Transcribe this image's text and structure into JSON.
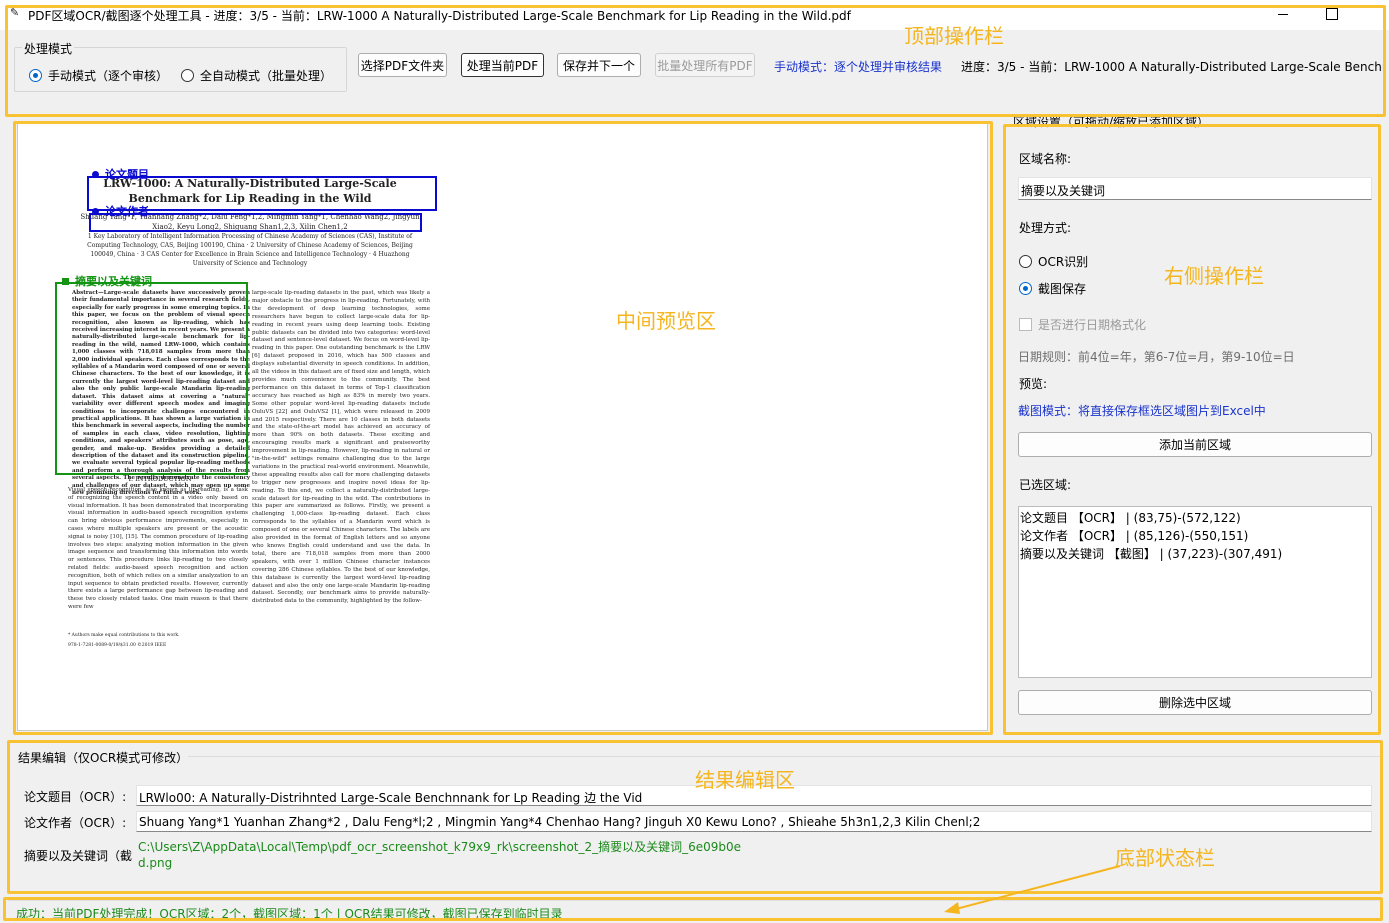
{
  "window": {
    "title": "PDF区域OCR/截图逐个处理工具 - 进度：3/5 - 当前：LRW-1000 A Naturally-Distributed Large-Scale Benchmark for Lip Reading in the Wild.pdf"
  },
  "annotations": {
    "top_bar": "顶部操作栏",
    "preview": "中间预览区",
    "right_panel": "右侧操作栏",
    "results": "结果编辑区",
    "status": "底部状态栏"
  },
  "toolbar": {
    "mode_group_title": "处理模式",
    "mode_manual": "手动模式（逐个审核）",
    "mode_auto": "全自动模式（批量处理）",
    "selected_mode": "manual",
    "select_folder": "选择PDF文件夹",
    "process_current": "处理当前PDF",
    "save_next": "保存并下一个",
    "batch_process": "批量处理所有PDF",
    "mode_hint": "手动模式：逐个处理并审核结果",
    "progress": "进度：3/5 - 当前：LRW-1000 A Naturally-Distributed Large-Scale Benchmark for Lip Reading in the Wild.pdf"
  },
  "preview": {
    "regions": [
      {
        "label": "论文题目",
        "color": "#0a0ad0"
      },
      {
        "label": "论文作者",
        "color": "#0a0ad0"
      },
      {
        "label": "摘要以及关键词",
        "color": "#139413"
      }
    ],
    "paper": {
      "title": "LRW-1000: A Naturally-Distributed Large-Scale Benchmark for Lip Reading in the Wild",
      "authors": "Shuang Yang*1, Yuanhang Zhang*2, Dalu Feng*1,2, Mingmin Yang*1, Chenhao Wang2, Jingyun Xiao2, Keyu Long2, Shiguang Shan1,2,3, Xilin Chen1,2",
      "affiliations": "1 Key Laboratory of Intelligent Information Processing of Chinese Academy of Sciences (CAS), Institute of Computing Technology, CAS, Beijing 100190, China · 2 University of Chinese Academy of Sciences, Beijing 100049, China · 3 CAS Center for Excellence in Brain Science and Intelligence Technology · 4 Huazhong University of Science and Technology",
      "abstract": "Abstract—Large-scale datasets have successively proven their fundamental importance in several research fields, especially for early progress in some emerging topics. In this paper, we focus on the problem of visual speech recognition, also known as lip-reading, which has received increasing interest in recent years. We present a naturally-distributed large-scale benchmark for lip-reading in the wild, named LRW-1000, which contains 1,000 classes with 718,018 samples from more than 2,000 individual speakers. Each class corresponds to the syllables of a Mandarin word composed of one or several Chinese characters. To the best of our knowledge, it is currently the largest word-level lip-reading dataset and also the only public large-scale Mandarin lip-reading dataset. This dataset aims at covering a \"natural\" variability over different speech modes and imaging conditions to incorporate challenges encountered in practical applications. It has shown a large variation in this benchmark in several aspects, including the number of samples in each class, video resolution, lighting conditions, and speakers' attributes such as pose, age, gender, and make-up. Besides providing a detailed description of the dataset and its construction pipeline, we evaluate several typical popular lip-reading methods and perform a thorough analysis of the results from several aspects. The results demonstrate the consistency and challenges of our dataset, which may open up some new promising directions for future work.",
      "intro_heading": "I. INTRODUCTION",
      "col_left": "Visual speech recognition, also known as lip-reading, is a task of recognizing the speech content in a video only based on visual information. It has been demonstrated that incorporating visual information in audio-based speech recognition systems can bring obvious performance improvements, especially in cases where multiple speakers are present or the acoustic signal is noisy [10], [15]. The common procedure of lip-reading involves two steps: analyzing motion information in the given image sequence and transforming this information into words or sentences. This procedure links lip-reading to two closely related fields: audio-based speech recognition and action recognition, both of which relies on a similar analyzation to an input sequence to obtain predicted results. However, currently there exists a large performance gap between lip-reading and these two closely related tasks. One main reason is that there were few",
      "col_right": "large-scale lip-reading datasets in the past, which was likely a major obstacle to the progress in lip-reading. Fortunately, with the development of deep learning technologies, some researchers have begun to collect large-scale data for lip-reading in recent years using deep learning tools. Existing public datasets can be divided into two categories: word-level dataset and sentence-level dataset. We focus on word-level lip-reading in this paper. One outstanding benchmark is the LRW [6] dataset proposed in 2016, which has 500 classes and displays substantial diversity in speech conditions. In addition, all the videos in this dataset are of fixed size and length, which provides much convenience to the community. The best performance on this dataset in terms of Top-1 classification accuracy has reached as high as 83% in merely two years. Some other popular word-level lip-reading datasets include OuluVS [22] and OuluVS2 [1], which were released in 2009 and 2015 respectively. There are 10 classes in both datasets and the state-of-the-art model has achieved an accuracy of more than 90% on both datasets. These exciting and encouraging results mark a significant and praiseworthy improvement in lip-reading. However, lip-reading in natural or \"in-the-wild\" settings remains challenging due to the large variations in the practical real-world environment. Meanwhile, these appealing results also call for more challenging datasets to trigger new progresses and inspire novel ideas for lip-reading. To this end, we collect a naturally-distributed large-scale dataset for lip-reading in the wild. The contributions in this paper are summarized as follows. Firstly, we present a challenging 1,000-class lip-reading dataset. Each class corresponds to the syllables of a Mandarin word which is composed of one or several Chinese characters. The labels are also provided in the format of English letters and so anyone who knows English could understand and use the data. In total, there are 718,018 samples from more than 2000 speakers, with over 1 million Chinese character instances covering 286 Chinese syllables. To the best of our knowledge, this database is currently the largest word-level lip-reading dataset and also the only one large-scale Mandarin lip-reading dataset. Secondly, our benchmark aims to provide naturally-distributed data to the community, highlighted by the follow-",
      "footnote": "* Authors make equal contributions to this work.",
      "copyright": "978-1-7281-0089-0/19/$31.00 ©2019 IEEE"
    }
  },
  "right_panel": {
    "legend": "区域设置（可拖动/缩放已添加区域）",
    "region_name_label": "区域名称:",
    "region_name_value": "摘要以及关键词",
    "method_label": "处理方式:",
    "method_ocr": "OCR识别",
    "method_screenshot": "截图保存",
    "selected_method": "screenshot",
    "date_format_label": "是否进行日期格式化",
    "date_format_checked": false,
    "date_rule": "日期规则：前4位=年，第6-7位=月，第9-10位=日",
    "preview_label": "预览:",
    "preview_hint": "截图模式：将直接保存框选区域图片到Excel中",
    "add_region": "添加当前区域",
    "selected_regions_label": "已选区域:",
    "selected_regions": [
      "论文题目 【OCR】 | (83,75)-(572,122)",
      "论文作者 【OCR】 | (85,126)-(550,151)",
      "摘要以及关键词 【截图】 | (37,223)-(307,491)"
    ],
    "delete_region": "删除选中区域"
  },
  "results": {
    "title": "结果编辑（仅OCR模式可修改）",
    "rows": [
      {
        "label": "论文题目（OCR）:",
        "value": "LRWlo00: A Naturally-Distrihnted Large-Scale Benchnnank for Lp Reading 边 the Vid"
      },
      {
        "label": "论文作者（OCR）:",
        "value": "Shuang Yang*1 Yuanhan Zhang*2 , Dalu Feng*l;2 , Mingmin  Yang*4 Chenhao Hang? Jinguh X0 Kewu Lono? , Shieahe 5h3n1,2,3 Kilin Chenl;2"
      },
      {
        "label": "摘要以及关键词（截图）:",
        "value": "C:\\Users\\Z\\AppData\\Local\\Temp\\pdf_ocr_screenshot_k79x9_rk\\screenshot_2_摘要以及关键词_6e09b0ed.png"
      }
    ]
  },
  "status": {
    "text": "成功：当前PDF处理完成！OCR区域：2个，截图区域：1个 | OCR结果可修改，截图已保存到临时目录"
  }
}
